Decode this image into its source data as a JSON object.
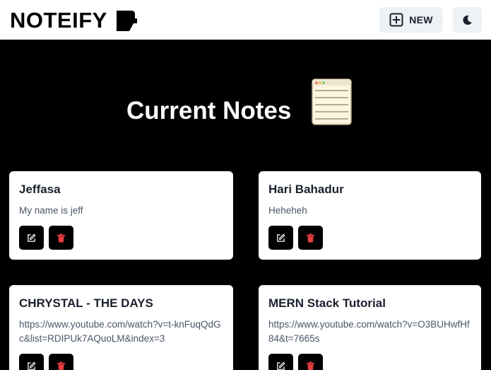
{
  "app": {
    "name": "NOTEIFY",
    "brand_icon": "note-sticky-icon"
  },
  "header": {
    "new_button_label": "NEW",
    "new_icon": "plus-square-icon",
    "theme_icon": "moon-icon"
  },
  "hero": {
    "title": "Current Notes",
    "icon": "notepad-icon"
  },
  "notes": [
    {
      "title": "Jeffasa",
      "description": "My name is jeff"
    },
    {
      "title": "Hari Bahadur",
      "description": "Heheheh"
    },
    {
      "title": "CHRYSTAL - THE DAYS",
      "description": "https://www.youtube.com/watch?v=t-knFuqQdGc&list=RDIPUk7AQuoLM&index=3"
    },
    {
      "title": "MERN Stack Tutorial",
      "description": "https://www.youtube.com/watch?v=O3BUHwfHf84&t=7665s"
    }
  ],
  "actions": {
    "edit_icon": "edit-icon",
    "delete_icon": "trash-icon"
  },
  "colors": {
    "background": "#000000",
    "navbar": "#ffffff",
    "button_bg": "#edf2f7",
    "card_bg": "#ffffff",
    "delete": "#e53e3e",
    "notepad_fill": "#fdf5e0"
  }
}
